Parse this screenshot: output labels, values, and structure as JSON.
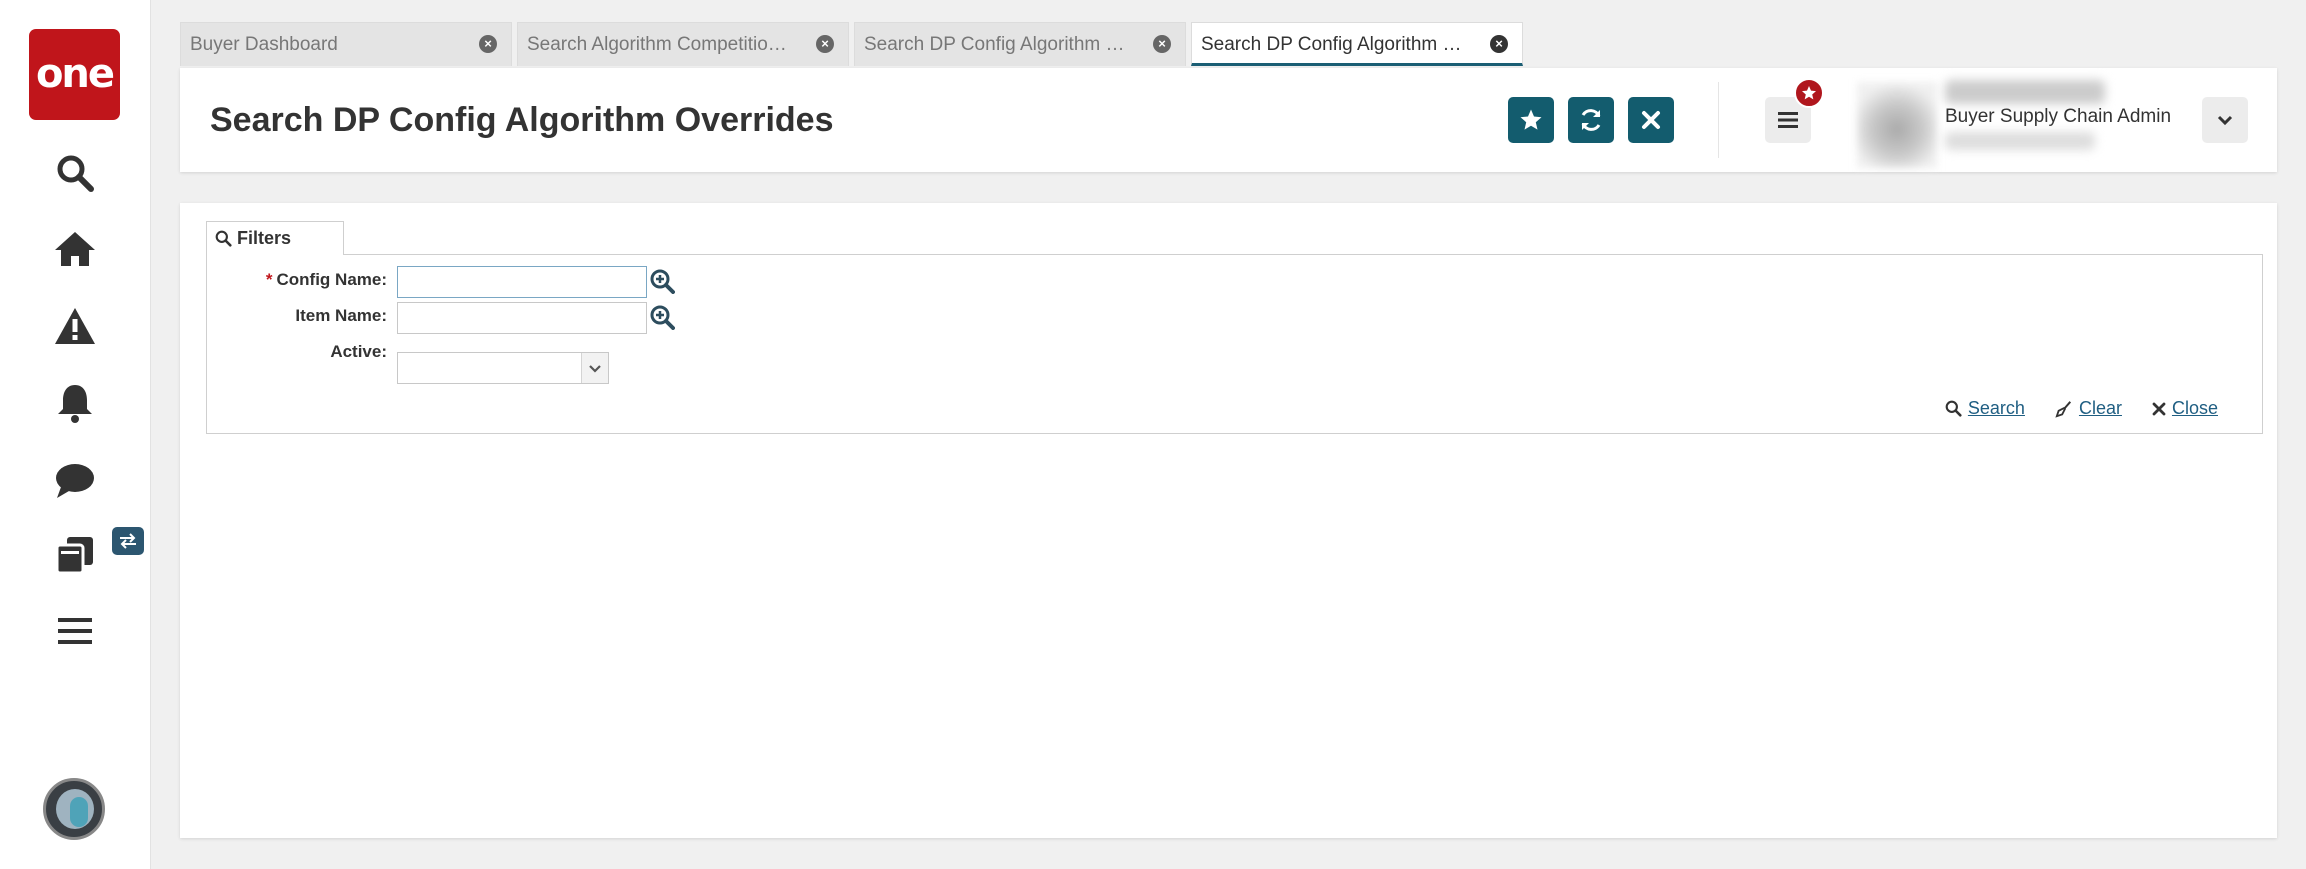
{
  "app": {
    "logo_text": "one",
    "brand_color": "#c0151b",
    "accent_color": "#135c6e"
  },
  "nav": {
    "items": [
      {
        "icon": "search-icon"
      },
      {
        "icon": "home-icon"
      },
      {
        "icon": "alert-icon"
      },
      {
        "icon": "bell-icon"
      },
      {
        "icon": "chat-icon"
      },
      {
        "icon": "documents-icon"
      },
      {
        "icon": "hamburger-icon"
      }
    ]
  },
  "tabs": [
    {
      "label": "Buyer Dashboard",
      "active": false
    },
    {
      "label": "Search Algorithm Competition C...",
      "active": false
    },
    {
      "label": "Search DP Config Algorithm Ove...",
      "active": false
    },
    {
      "label": "Search DP Config Algorithm Ove...",
      "active": true
    }
  ],
  "header": {
    "title": "Search DP Config Algorithm Overrides",
    "user_role": "Buyer Supply Chain Admin"
  },
  "filters": {
    "tab_label": "Filters",
    "fields": [
      {
        "label": "Config Name:",
        "required": true,
        "value": ""
      },
      {
        "label": "Item Name:",
        "required": false,
        "value": ""
      },
      {
        "label": "Active:",
        "required": false,
        "value": ""
      }
    ],
    "required_marker": "*",
    "actions": {
      "search": "Search",
      "clear": "Clear",
      "close": "Close"
    }
  }
}
